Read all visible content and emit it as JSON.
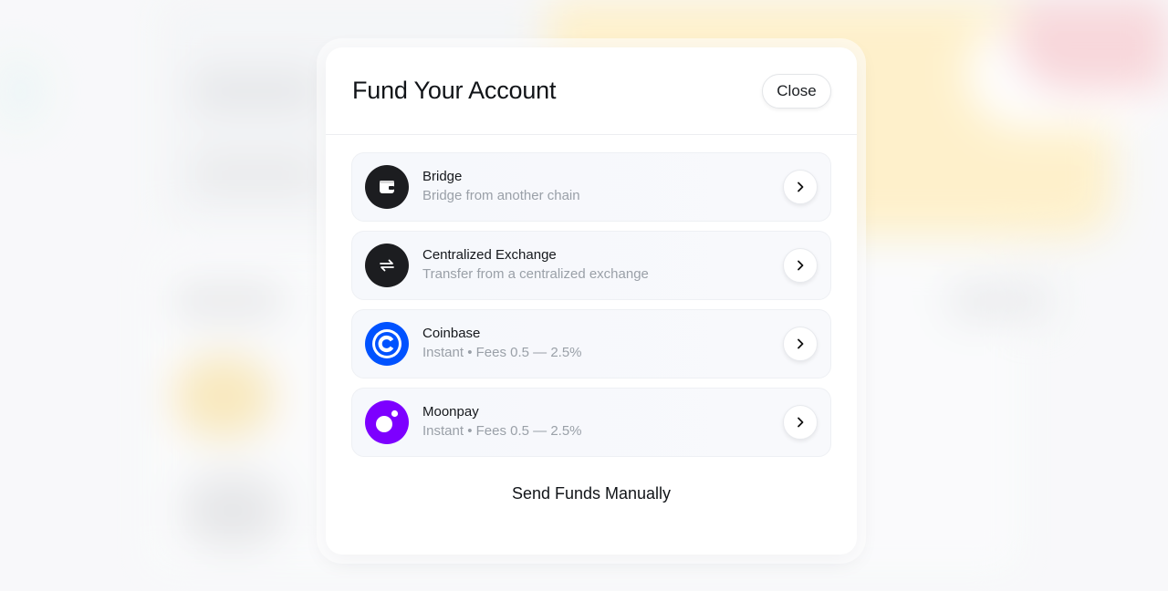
{
  "modal": {
    "title": "Fund Your Account",
    "close_label": "Close",
    "options": [
      {
        "title": "Bridge",
        "subtitle": "Bridge from another chain",
        "icon": "wallet-icon",
        "icon_bg": "#1c1d20"
      },
      {
        "title": "Centralized Exchange",
        "subtitle": "Transfer from a centralized exchange",
        "icon": "exchange-arrows-icon",
        "icon_bg": "#1c1d20"
      },
      {
        "title": "Coinbase",
        "subtitle": "Instant • Fees 0.5 — 2.5%",
        "icon": "coinbase-logo-icon",
        "icon_bg": "#0052ff"
      },
      {
        "title": "Moonpay",
        "subtitle": "Instant • Fees 0.5 — 2.5%",
        "icon": "moonpay-logo-icon",
        "icon_bg": "#7d00ff"
      }
    ],
    "manual_label": "Send Funds Manually"
  }
}
